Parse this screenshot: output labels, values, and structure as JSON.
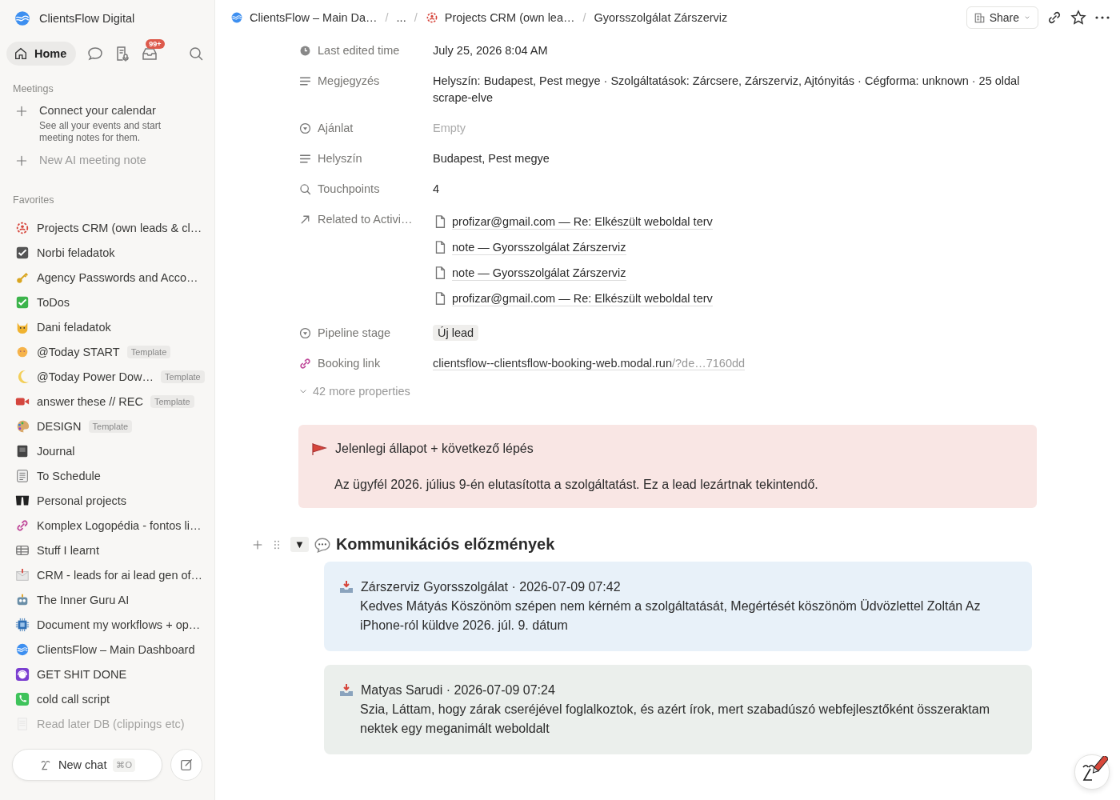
{
  "sidebar": {
    "workspace_name": "ClientsFlow Digital",
    "home_button": {
      "label": "Home",
      "selected": true
    },
    "inbox_badge": "99+",
    "meetings": {
      "heading": "Meetings",
      "connect_title": "Connect your calendar",
      "connect_description": "See all your events and start meeting notes for them.",
      "new_note": "New AI meeting note"
    },
    "favorites": {
      "heading": "Favorites",
      "items": [
        {
          "kind": "target",
          "label": "Projects CRM (own leads & cl…",
          "dimmed": false
        },
        {
          "kind": "checkbox",
          "label": "Norbi feladatok",
          "dimmed": false
        },
        {
          "kind": "key",
          "label": "Agency Passwords and Acco…",
          "dimmed": false
        },
        {
          "kind": "check",
          "label": "ToDos",
          "dimmed": false
        },
        {
          "kind": "cat",
          "label": "Dani feladatok",
          "dimmed": false
        },
        {
          "kind": "sun",
          "label": "@Today START",
          "tag": "Template",
          "dimmed": false
        },
        {
          "kind": "moon",
          "label": "@Today Power Dow…",
          "tag": "Template",
          "dimmed": false
        },
        {
          "kind": "camera",
          "label": "answer these // REC",
          "tag": "Template",
          "dimmed": false
        },
        {
          "kind": "palette",
          "label": "DESIGN",
          "tag": "Template",
          "dimmed": false
        },
        {
          "kind": "book",
          "label": "Journal",
          "dimmed": false
        },
        {
          "kind": "list",
          "label": "To Schedule",
          "dimmed": false
        },
        {
          "kind": "glasses",
          "label": "Personal projects",
          "dimmed": false
        },
        {
          "kind": "link",
          "label": "Komplex Logopédia - fontos li…",
          "dimmed": false
        },
        {
          "kind": "table",
          "label": "Stuff I learnt",
          "dimmed": false
        },
        {
          "kind": "mail",
          "label": "CRM - leads for ai lead gen of…",
          "dimmed": false
        },
        {
          "kind": "robot",
          "label": "The Inner Guru AI",
          "dimmed": false
        },
        {
          "kind": "chip",
          "label": "Document my workflows + op…",
          "dimmed": false
        },
        {
          "kind": "logo",
          "label": "ClientsFlow – Main Dashboard",
          "dimmed": false
        },
        {
          "kind": "headset",
          "label": "GET SHIT DONE",
          "dimmed": false
        },
        {
          "kind": "phone",
          "label": "cold call script",
          "dimmed": false
        },
        {
          "kind": "doc",
          "label": "Read later DB (clippings etc)",
          "dimmed": true
        }
      ]
    },
    "new_chat": {
      "label": "New chat",
      "shortcut": "⌘O"
    }
  },
  "breadcrumb": [
    {
      "kind": "logo",
      "label": "ClientsFlow – Main Da…"
    },
    {
      "kind": "plain",
      "separator": "/",
      "label": "..."
    },
    {
      "kind": "target",
      "separator": "/",
      "label": "Projects CRM (own lea…"
    },
    {
      "kind": "plain",
      "separator": "/",
      "label": "Gyorsszolgálat Zárszerviz"
    }
  ],
  "share_button": "Share",
  "properties": [
    {
      "kind": "date",
      "label": "Last edited time",
      "value": "July 25, 2026 8:04 AM"
    },
    {
      "kind": "text",
      "label": "Megjegyzés",
      "value": "Helyszín: Budapest, Pest megye · Szolgáltatások: Zárcsere, Zárszerviz, Ajtónyitás · Cégforma: unknown · 25 oldal scrape-elve"
    },
    {
      "kind": "select",
      "label": "Ajánlat",
      "value": "Empty"
    },
    {
      "kind": "text",
      "label": "Helyszín",
      "value": "Budapest, Pest megye"
    },
    {
      "kind": "number",
      "label": "Touchpoints",
      "value": "4"
    },
    {
      "kind": "relation",
      "label": "Related to Activi…",
      "items": [
        "profizar@gmail.com — Re: Elkészült weboldal terv",
        "note — Gyorsszolgálat Zárszerviz",
        "note — Gyorsszolgálat Zárszerviz",
        "profizar@gmail.com — Re: Elkészült weboldal terv"
      ]
    },
    {
      "kind": "status",
      "label": "Pipeline stage",
      "value": "Új lead"
    },
    {
      "kind": "url",
      "label": "Booking link",
      "value": "clientsflow--clientsflow-booking-web.modal.run",
      "suffix": "/?de…7160dd"
    }
  ],
  "more_properties": "42 more properties",
  "callout": {
    "title": "Jelenlegi állapot + következő lépés",
    "body": "Az ügyfél 2026. július 9-én elutasította a szolgáltatást. Ez a lead lezártnak tekintendő."
  },
  "section": {
    "toggle": "▼",
    "expanded": true,
    "title": "Kommunikációs előzmények",
    "messages": [
      {
        "color": "#e8f1f9",
        "header": "Zárszerviz Gyorsszolgálat · 2026-07-09 07:42",
        "body": "Kedves Mátyás Köszönöm szépen nem kérném a szolgáltatását, Megértését köszönöm Üdvözlettel Zoltán Az iPhone-ról küldve 2026. júl. 9. dátum"
      },
      {
        "color": "#ebefec",
        "header": "Matyas Sarudi · 2026-07-09 07:24",
        "body": "Szia, Láttam, hogy zárak cseréjével foglalkoztok, és azért írok, mert szabadúszó webfejlesztőként összeraktam nektek egy meganimált weboldalt"
      }
    ]
  }
}
